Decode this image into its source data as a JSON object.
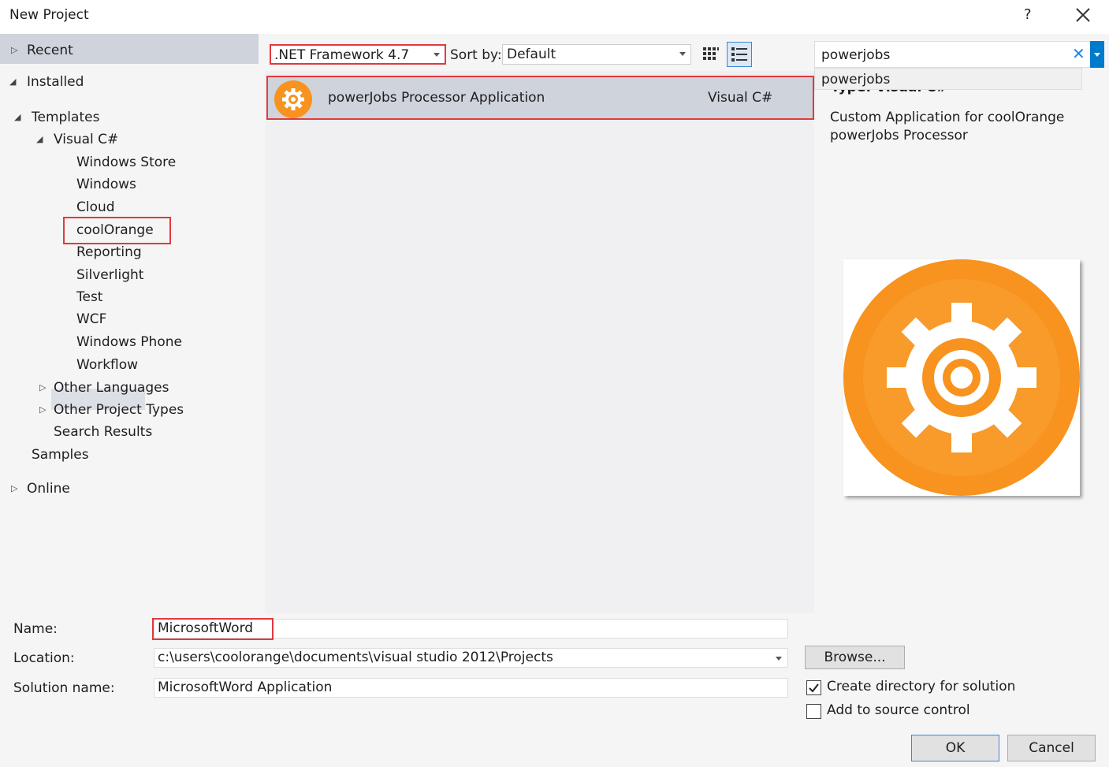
{
  "window": {
    "title": "New Project",
    "help": "?",
    "close_icon": "close-icon"
  },
  "tree": {
    "recent": "Recent",
    "installed": "Installed",
    "templates": "Templates",
    "visual_csharp": "Visual C#",
    "children": [
      "Windows Store",
      "Windows",
      "Cloud",
      "coolOrange",
      "Reporting",
      "Silverlight",
      "Test",
      "WCF",
      "Windows Phone",
      "Workflow"
    ],
    "other_languages": "Other Languages",
    "other_project_types": "Other Project Types",
    "search_results": "Search Results",
    "samples": "Samples",
    "online": "Online"
  },
  "toolbar": {
    "framework": ".NET Framework 4.7",
    "sort_label": "Sort by:",
    "sort_value": "Default"
  },
  "template": {
    "name": "powerJobs Processor Application",
    "language": "Visual C#",
    "icon": "gear-icon",
    "icon_color": "#f7931e"
  },
  "search": {
    "value": "powerjobs",
    "suggestion": "powerjobs"
  },
  "details": {
    "type_partial": "Type:  Visual C#",
    "description": "Custom Application for coolOrange powerJobs Processor"
  },
  "form": {
    "name_label": "Name:",
    "name_value": "MicrosoftWord",
    "location_label": "Location:",
    "location_value": "c:\\users\\coolorange\\documents\\visual studio 2012\\Projects",
    "solution_label": "Solution name:",
    "solution_value": "MicrosoftWord Application",
    "browse": "Browse...",
    "create_dir": "Create directory for solution",
    "create_dir_checked": true,
    "source_control": "Add to source control",
    "source_control_checked": false,
    "ok": "OK",
    "cancel": "Cancel"
  },
  "colors": {
    "highlight_red": "#e03a3e",
    "selection": "#cfd3dc",
    "accent_blue": "#007acc",
    "orange": "#f7931e"
  }
}
